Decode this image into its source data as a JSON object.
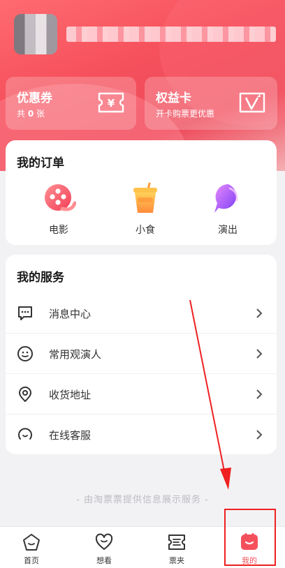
{
  "coupon": {
    "title": "优惠券",
    "sub_prefix": "共",
    "count": "0",
    "sub_suffix": "张"
  },
  "benefit": {
    "title": "权益卡",
    "sub": "开卡购票更优惠"
  },
  "orders": {
    "title": "我的订单",
    "items": [
      {
        "label": "电影",
        "icon": "movie-icon"
      },
      {
        "label": "小食",
        "icon": "snack-cup-icon"
      },
      {
        "label": "演出",
        "icon": "show-icon"
      }
    ]
  },
  "services": {
    "title": "我的服务",
    "items": [
      {
        "label": "消息中心",
        "icon": "message-icon"
      },
      {
        "label": "常用观演人",
        "icon": "smiley-icon"
      },
      {
        "label": "收货地址",
        "icon": "location-icon"
      },
      {
        "label": "在线客服",
        "icon": "customer-service-icon"
      }
    ]
  },
  "footer_note": "- 由淘票票提供信息展示服务 -",
  "tabbar": {
    "items": [
      {
        "label": "首页",
        "icon": "home-icon"
      },
      {
        "label": "想看",
        "icon": "heart-icon"
      },
      {
        "label": "票夹",
        "icon": "ticket-folder-icon"
      },
      {
        "label": "我的",
        "icon": "profile-icon",
        "active": true
      }
    ]
  },
  "colors": {
    "accent": "#f5505c",
    "annotation": "#ee2020"
  }
}
